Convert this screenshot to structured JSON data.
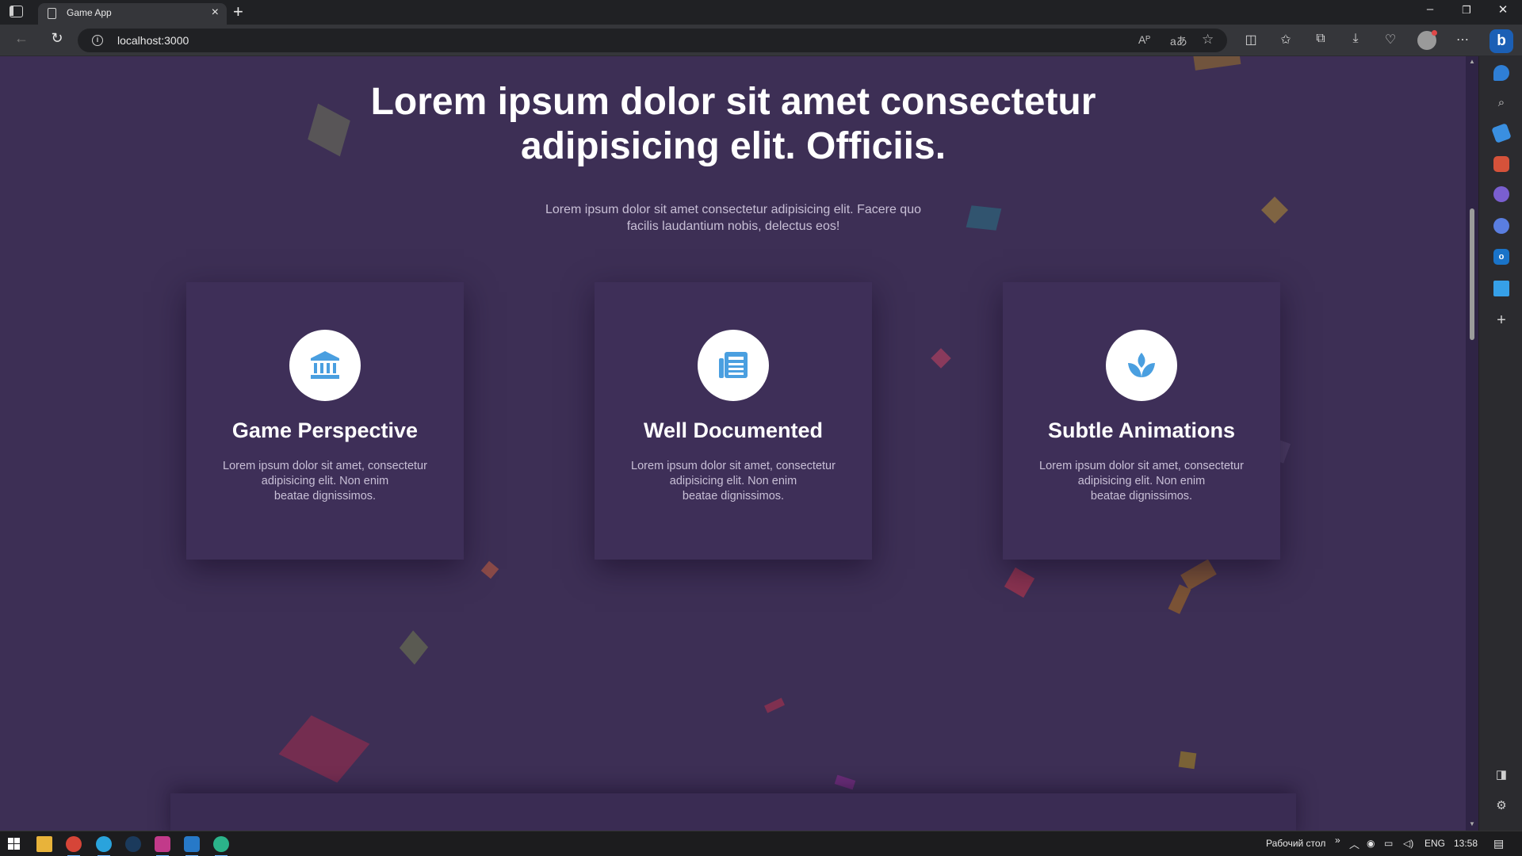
{
  "browser": {
    "tab_title": "Game App",
    "tab_close": "×",
    "new_tab": "+",
    "url": "localhost:3000",
    "read_aloud": "Aᴾ",
    "translate": "aあ",
    "window_controls": {
      "minimize": "–",
      "restore": "❐",
      "close": "✕"
    }
  },
  "hero": {
    "title_line1": "Lorem ipsum dolor sit amet consectetur",
    "title_line2": "adipisicing elit. Officiis.",
    "subtitle_line1": "Lorem ipsum dolor sit amet consectetur adipisicing elit. Facere quo",
    "subtitle_line2": "facilis laudantium nobis, delectus eos!"
  },
  "cards": [
    {
      "icon": "bank-icon",
      "title": "Game Perspective",
      "text_line1": "Lorem ipsum dolor sit amet, consectetur",
      "text_line2": "adipisicing elit. Non enim",
      "text_line3": "beatae dignissimos."
    },
    {
      "icon": "newspaper-icon",
      "title": "Well Documented",
      "text_line1": "Lorem ipsum dolor sit amet, consectetur",
      "text_line2": "adipisicing elit. Non enim",
      "text_line3": "beatae dignissimos."
    },
    {
      "icon": "spa-icon",
      "title": "Subtle Animations",
      "text_line1": "Lorem ipsum dolor sit amet, consectetur",
      "text_line2": "adipisicing elit. Non enim",
      "text_line3": "beatae dignissimos."
    }
  ],
  "taskbar": {
    "desktop_label": "Рабочий стол",
    "chevron": "»",
    "language": "ENG",
    "time": "13:58"
  },
  "colors": {
    "page_background": "#3d2f55",
    "card_background": "#3e2f58",
    "icon_accent": "#4a9fe0"
  }
}
